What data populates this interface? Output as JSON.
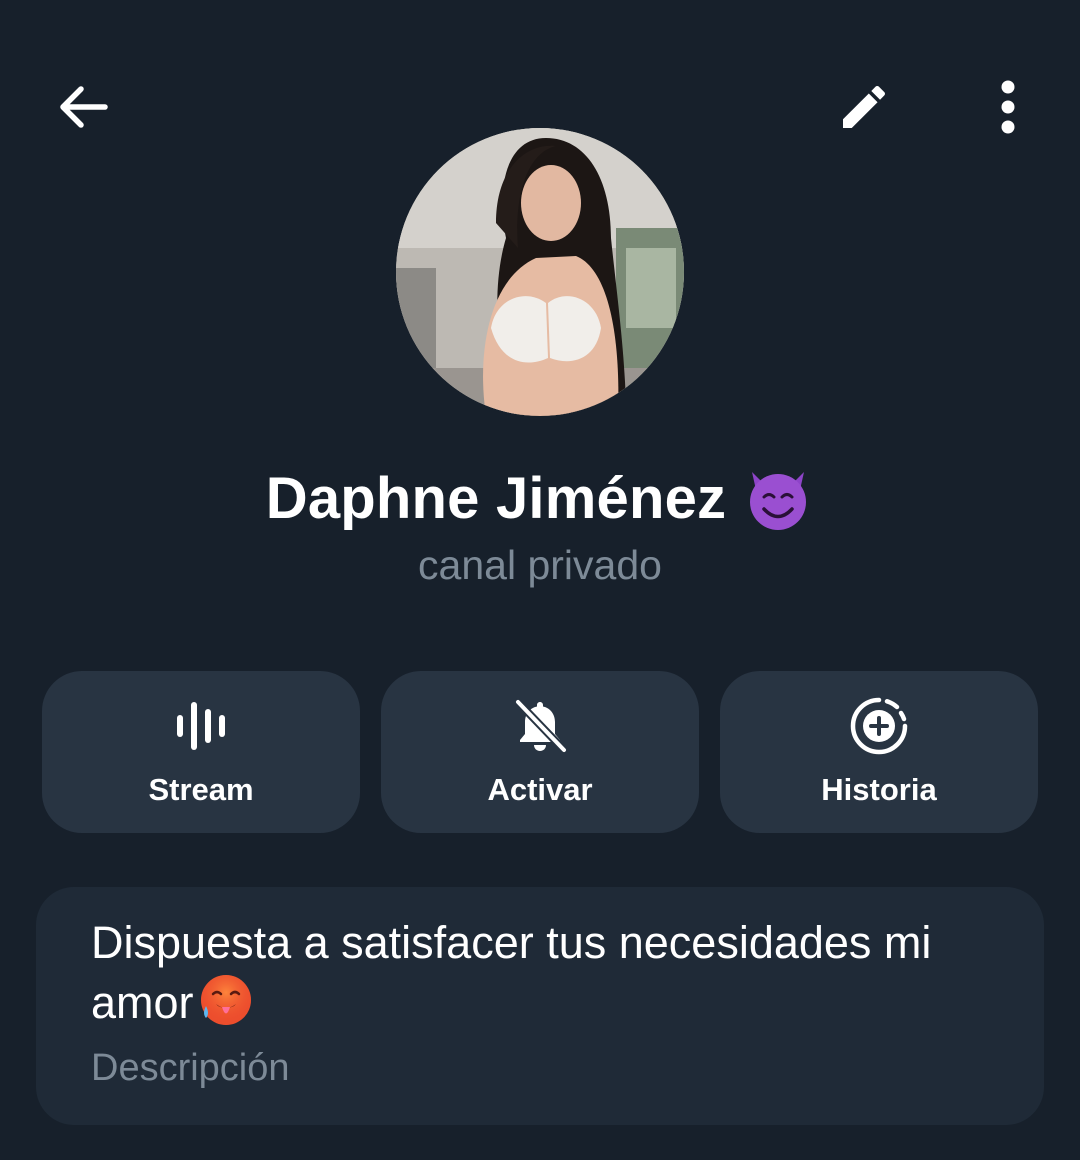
{
  "header": {
    "back_icon": "arrow-left-icon",
    "edit_icon": "pencil-icon",
    "more_icon": "more-vertical-icon"
  },
  "profile": {
    "name": "Daphne Jiménez",
    "name_emoji": "smiling-face-with-horns-emoji",
    "subtitle": "canal privado"
  },
  "actions": [
    {
      "label": "Stream",
      "icon": "voice-chat-icon"
    },
    {
      "label": "Activar",
      "icon": "bell-off-icon"
    },
    {
      "label": "Historia",
      "icon": "story-add-icon"
    }
  ],
  "description": {
    "text": "Dispuesta a satisfacer tus necesidades mi amor",
    "emoji": "hot-face-emoji",
    "label": "Descripción"
  },
  "colors": {
    "background": "#17202b",
    "button_bg": "#283442",
    "card_bg": "#1f2a37",
    "muted_text": "#7d8a97",
    "emoji_purple": "#8e44c9"
  }
}
